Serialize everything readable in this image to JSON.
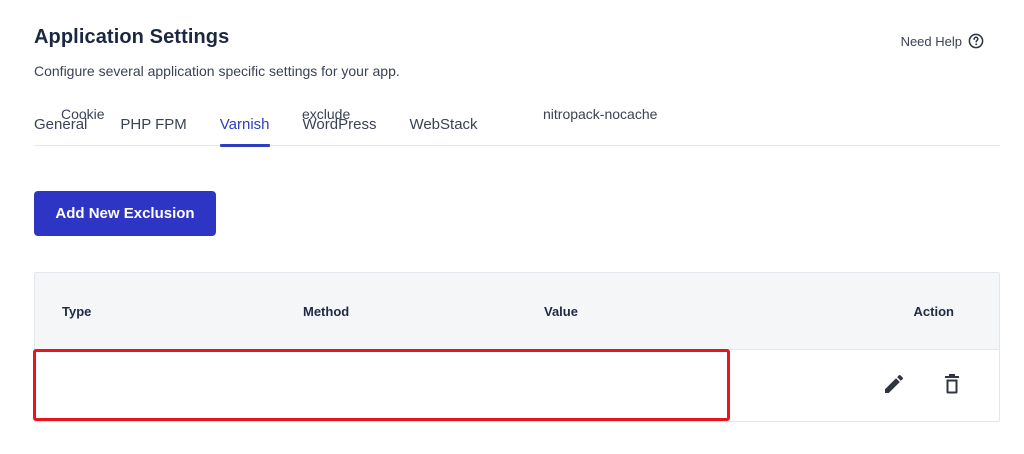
{
  "header": {
    "title": "Application Settings",
    "subtitle": "Configure several application specific settings for your app.",
    "help_label": "Need Help"
  },
  "tabs": [
    {
      "label": "General",
      "active": false
    },
    {
      "label": "PHP FPM",
      "active": false
    },
    {
      "label": "Varnish",
      "active": true
    },
    {
      "label": "WordPress",
      "active": false
    },
    {
      "label": "WebStack",
      "active": false
    }
  ],
  "actions": {
    "add_label": "Add New Exclusion"
  },
  "table": {
    "columns": [
      "Type",
      "Method",
      "Value",
      "Action"
    ],
    "rows": [
      {
        "type": "Cookie",
        "method": "exclude",
        "value": "nitropack-nocache"
      }
    ]
  },
  "colors": {
    "accent": "#2e35c4",
    "active_tab": "#2f3dbf",
    "highlight": "#e8141f"
  },
  "icons": {
    "help": "question-circle-icon",
    "edit": "pencil-icon",
    "delete": "trash-icon"
  }
}
